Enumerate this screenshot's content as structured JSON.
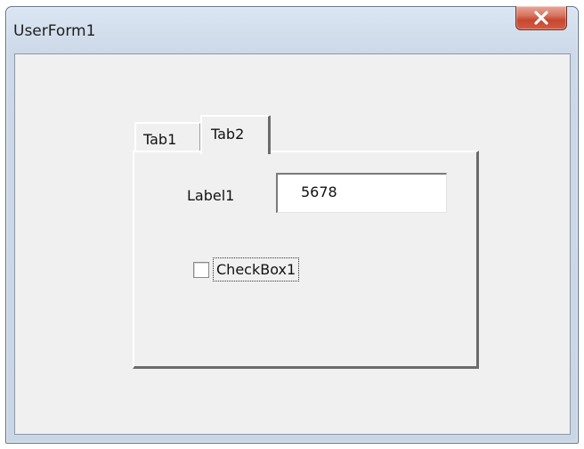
{
  "window": {
    "title": "UserForm1",
    "close_icon": "close-icon"
  },
  "tabs": [
    {
      "label": "Tab1",
      "selected": false
    },
    {
      "label": "Tab2",
      "selected": true
    }
  ],
  "form": {
    "label1": "Label1",
    "textbox_value": "5678",
    "checkbox_label": "CheckBox1",
    "checkbox_checked": false
  },
  "colors": {
    "close_button": "#c7462f",
    "client_background": "#f0f0f0",
    "frame": "#cdd9e8"
  }
}
